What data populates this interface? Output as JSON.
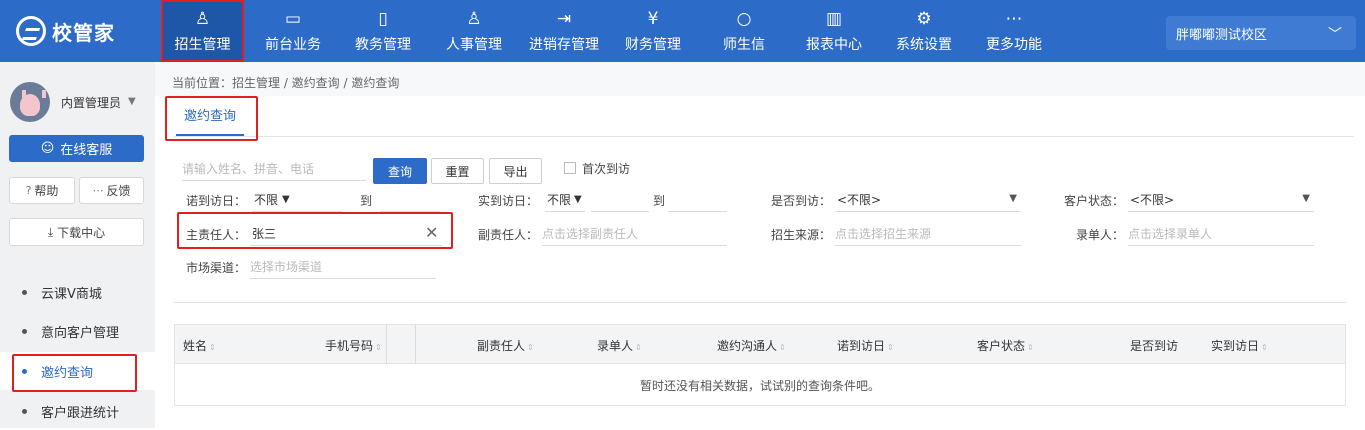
{
  "app": {
    "logo_text": "校管家"
  },
  "nav": [
    {
      "label": "招生管理",
      "icon": "person-plus-icon",
      "glyph": "♙"
    },
    {
      "label": "前台业务",
      "icon": "monitor-icon",
      "glyph": "▭"
    },
    {
      "label": "教务管理",
      "icon": "book-icon",
      "glyph": "▯"
    },
    {
      "label": "人事管理",
      "icon": "user-icon",
      "glyph": "♙"
    },
    {
      "label": "进销存管理",
      "icon": "box-arrow-icon",
      "glyph": "⇥"
    },
    {
      "label": "财务管理",
      "icon": "yen-shield-icon",
      "glyph": "¥"
    },
    {
      "label": "师生信",
      "icon": "chat-bubble-icon",
      "glyph": "○"
    },
    {
      "label": "报表中心",
      "icon": "bar-chart-icon",
      "glyph": "▥"
    },
    {
      "label": "系统设置",
      "icon": "gear-icon",
      "glyph": "⚙"
    },
    {
      "label": "更多功能",
      "icon": "more-dots-icon",
      "glyph": "⋯"
    }
  ],
  "campus": {
    "name": "胖嘟嘟测试校区"
  },
  "sidebar": {
    "user_name": "内置管理员",
    "service_label": "在线客服",
    "help_label": "帮助",
    "feedback_label": "反馈",
    "download_label": "下载中心",
    "items": [
      {
        "label": "云课V商城"
      },
      {
        "label": "意向客户管理"
      },
      {
        "label": "邀约查询"
      },
      {
        "label": "客户跟进统计"
      }
    ]
  },
  "breadcrumb": "当前位置：招生管理 / 邀约查询 / 邀约查询",
  "tab": {
    "label": "邀约查询"
  },
  "search": {
    "placeholder": "请输入姓名、拼音、电话",
    "query_label": "查询",
    "reset_label": "重置",
    "export_label": "导出",
    "first_visit_label": "首次到访"
  },
  "filters": {
    "promise_date_label": "诺到访日：",
    "promise_date_value": "不限",
    "to_label": "到",
    "actual_date_label": "实到访日：",
    "actual_date_value": "不限",
    "visited_label": "是否到访：",
    "visited_value": "<不限>",
    "status_label": "客户状态：",
    "status_value": "<不限>",
    "owner_label": "主责任人：",
    "owner_value": "张三",
    "deputy_label": "副责任人：",
    "deputy_placeholder": "点击选择副责任人",
    "source_label": "招生来源：",
    "source_placeholder": "点击选择招生来源",
    "recorder_label": "录单人：",
    "recorder_placeholder": "点击选择录单人",
    "channel_label": "市场渠道：",
    "channel_placeholder": "选择市场渠道"
  },
  "table": {
    "columns": [
      "姓名",
      "手机号码",
      "副责任人",
      "录单人",
      "邀约沟通人",
      "诺到访日",
      "客户状态",
      "是否到访",
      "实到访日"
    ],
    "empty_text": "暂时还没有相关数据，试试别的查询条件吧。"
  },
  "colors": {
    "primary": "#2c6bc7",
    "highlight": "#e02020"
  }
}
